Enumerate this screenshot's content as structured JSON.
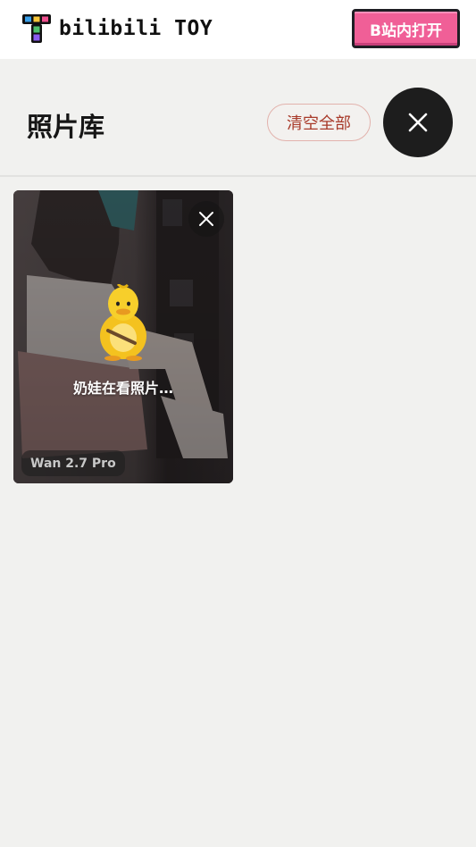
{
  "topbar": {
    "logo_text": "bilibili TOY",
    "open_in_app_label": "B站内打开"
  },
  "header": {
    "title": "照片库",
    "clear_all_label": "清空全部"
  },
  "photos": [
    {
      "status": "奶娃在看照片…",
      "model": "Wan 2.7 Pro"
    }
  ],
  "icons": {
    "logo": "bilibili-toy-logo-icon",
    "close": "close-icon",
    "remove": "remove-photo-icon",
    "mascot": "duck-mascot-icon"
  },
  "colors": {
    "brand_pink": "#f05f97",
    "clear_text": "#a83a2a",
    "page_bg": "#f1f1ef"
  }
}
